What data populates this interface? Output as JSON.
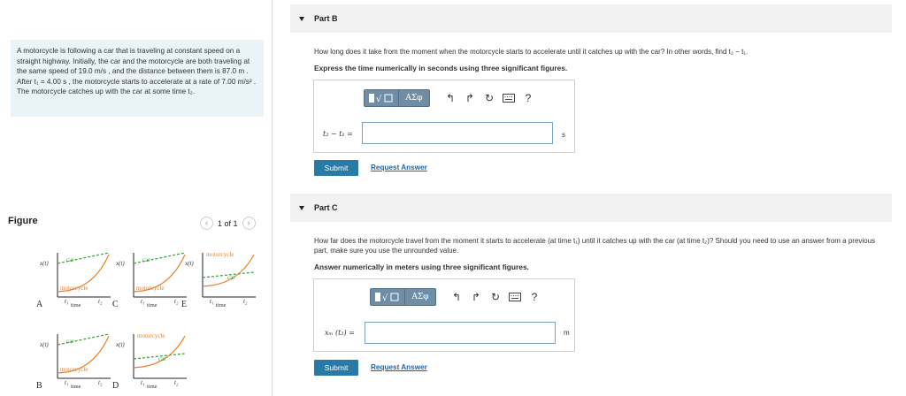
{
  "problem": {
    "text": "A motorcycle is following a car that is traveling at constant speed on a straight highway. Initially, the car and the motorcycle are both traveling at the same speed of 19.0 m/s , and the distance between them is 87.0 m . After t₁ = 4.00 s , the motorcycle starts to accelerate at a rate of 7.00 m/s² . The motorcycle catches up with the car at some time t₂."
  },
  "figure": {
    "label": "Figure",
    "pager_text": "1 of 1",
    "graphs": [
      {
        "letter": "A",
        "top": "car",
        "bottom": "motorcycle"
      },
      {
        "letter": "C",
        "top": "car",
        "bottom": "motorcycle"
      },
      {
        "letter": "E",
        "top": "motorcycle",
        "bottom": "car"
      },
      {
        "letter": "B",
        "top": "car",
        "bottom": "motorcycle"
      },
      {
        "letter": "D",
        "top": "motorcycle",
        "bottom": "car"
      }
    ],
    "x_axis_label": "time",
    "y_axis_label": "x(t)",
    "t1_label": "t₁",
    "t2_label": "t₂",
    "colors": {
      "car": "#3aa83a",
      "motorcycle": "#e8812b"
    }
  },
  "partB": {
    "title": "Part B",
    "question": "How long does it take from the moment when the motorcycle starts to accelerate until it catches up with the car? In other words, find t₂ − t₁.",
    "instruction": "Express the time numerically in seconds using three significant figures.",
    "answer_label": "t₂ − t₁ =",
    "answer_value": "",
    "unit": "s",
    "submit": "Submit",
    "request": "Request Answer"
  },
  "partC": {
    "title": "Part C",
    "question": "How far does the motorcycle travel from the moment it starts to accelerate (at time t₁) until it catches up with the car (at time t₂)? Should you need to use an answer from a previous part, make sure you use the unrounded value.",
    "instruction": "Answer numerically in meters using three significant figures.",
    "answer_label": "xₘ (t₂) =",
    "answer_value": "",
    "unit": "m",
    "submit": "Submit",
    "request": "Request Answer"
  },
  "toolbar": {
    "greek_label": "ΑΣφ",
    "help_label": "?",
    "icons": [
      "templates-icon",
      "greek-icon",
      "undo-icon",
      "redo-icon",
      "reset-icon",
      "keyboard-icon",
      "help-icon"
    ]
  }
}
